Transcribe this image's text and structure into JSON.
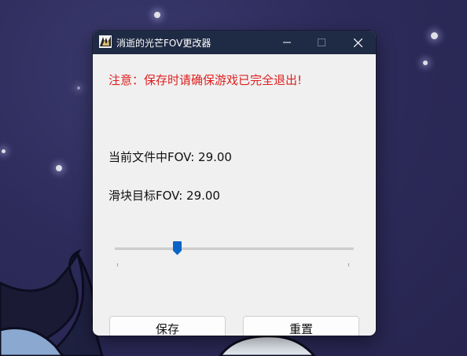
{
  "window": {
    "title": "消逝的光芒FOV更改器"
  },
  "main": {
    "warning": "注意：保存时请确保游戏已完全退出!",
    "current_fov_label": "当前文件中FOV: 29.00",
    "target_fov_label": "滑块目标FOV: 29.00",
    "slider_level": 0.26
  },
  "buttons": {
    "save_label": "保存",
    "reset_label": "重置"
  },
  "colors": {
    "titlebar": "#1f2b45",
    "warning_text": "#e02020",
    "slider_thumb": "#0a64c8",
    "window_bg": "#f0f0f0"
  },
  "icons": {
    "app": "app-icon",
    "minimize": "minimize-icon",
    "maximize": "maximize-icon",
    "close": "close-icon"
  }
}
